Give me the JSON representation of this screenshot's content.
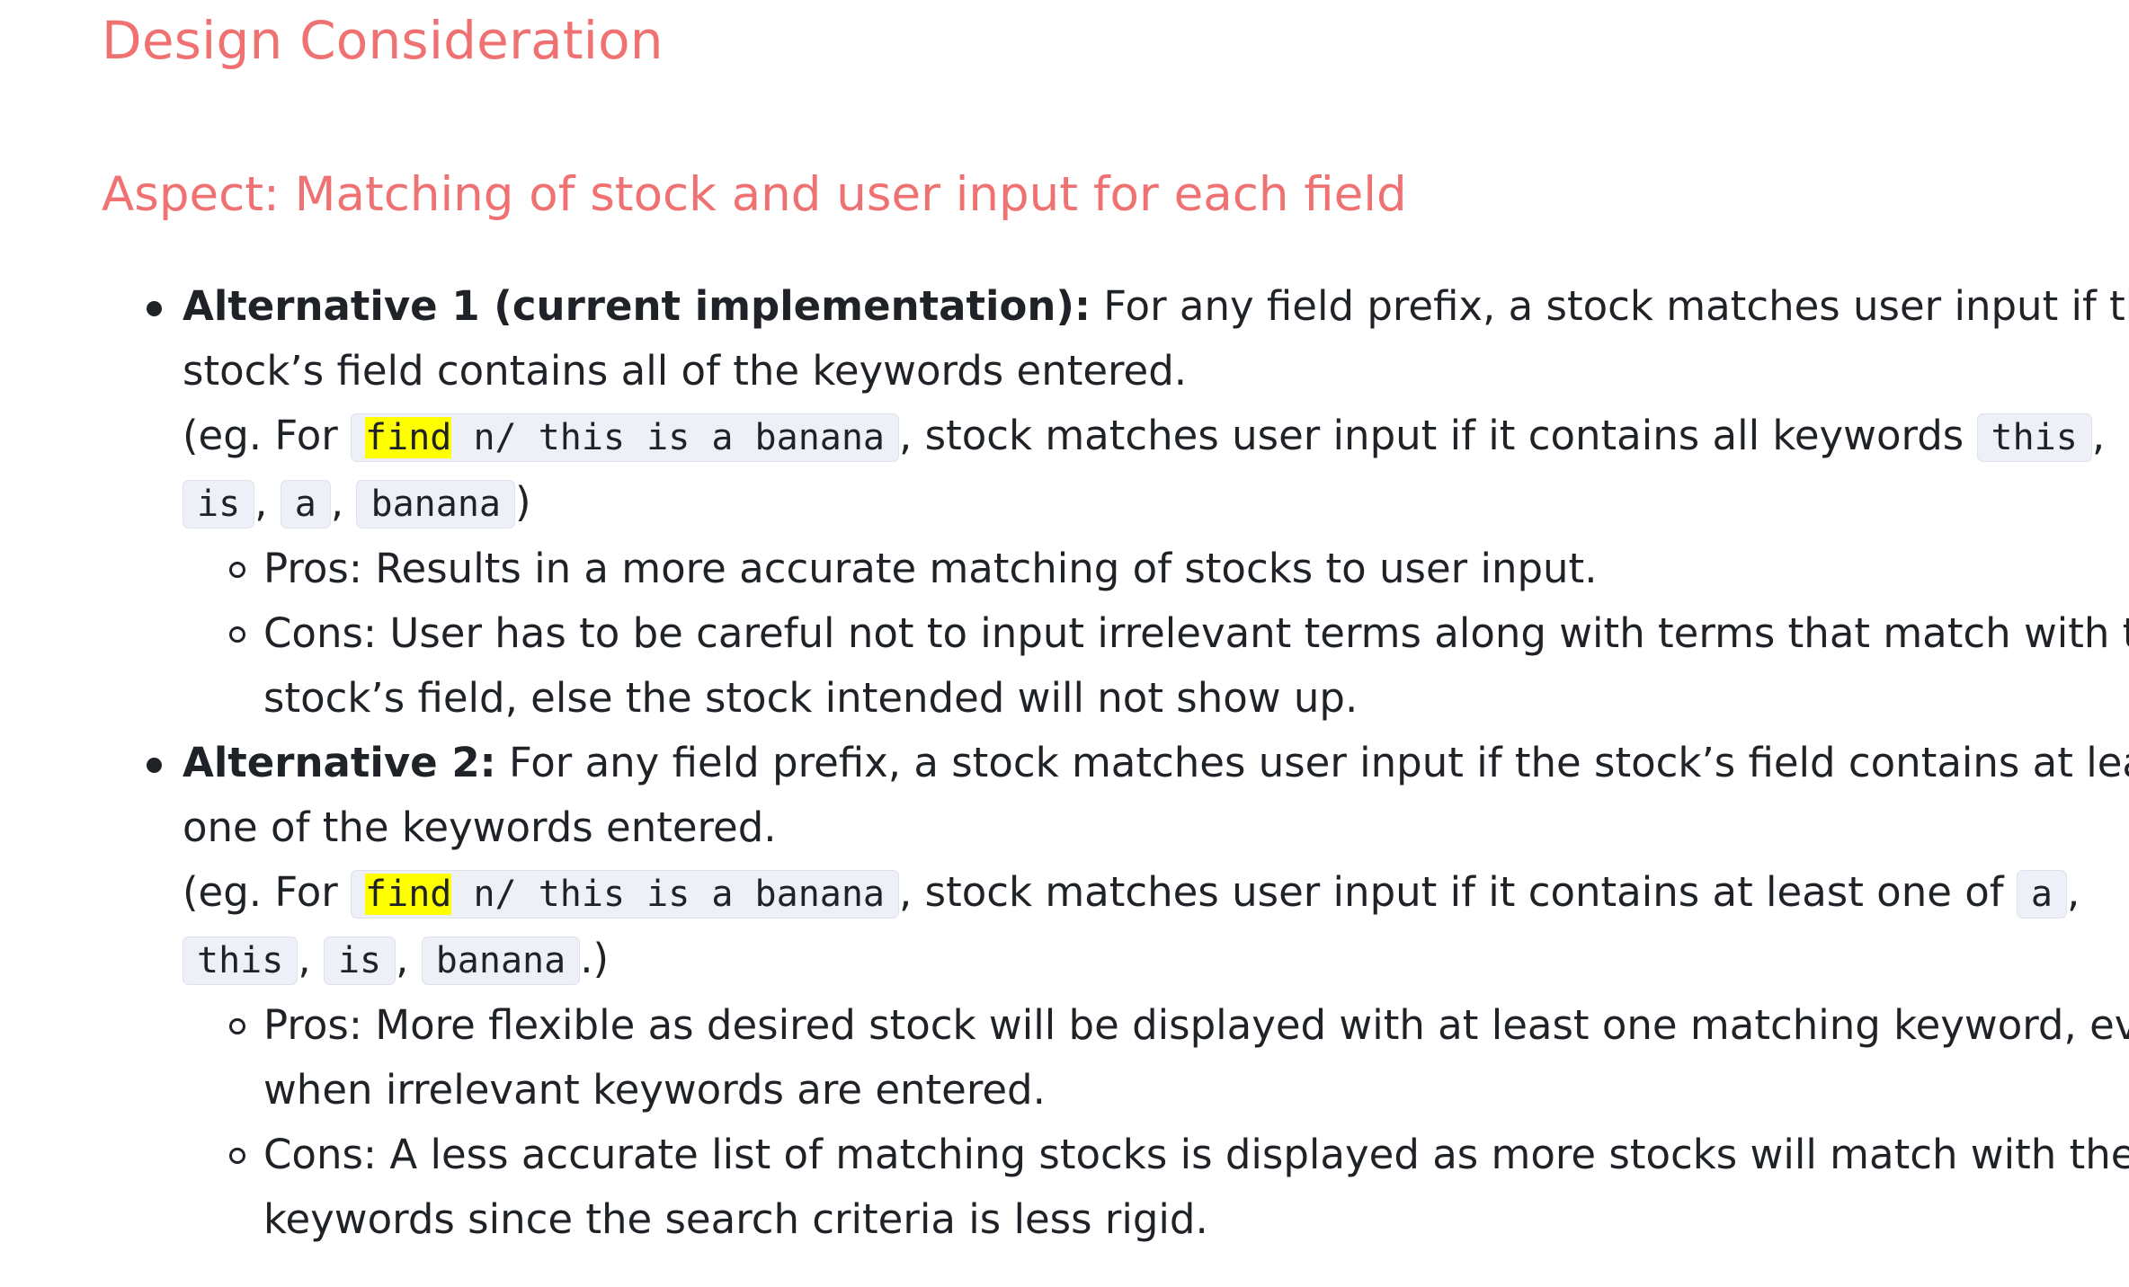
{
  "section_title": "Design Consideration",
  "aspect_title": "Aspect: Matching of stock and user input for each field",
  "alternatives": [
    {
      "name": "Alternative 1 (current implementation):",
      "desc": "For any field prefix, a stock matches user input if the stock’s field contains all of the keywords entered.",
      "eg_prefix": "(eg. For",
      "cmd_highlight": "find",
      "cmd_rest": " n/ this is a banana",
      "eg_middle": ", stock matches user input if it contains all keywords",
      "keywords": [
        "this",
        "is",
        "a",
        "banana"
      ],
      "eg_end": ")",
      "pros": "Pros: Results in a more accurate matching of stocks to user input.",
      "cons": "Cons: User has to be careful not to input irrelevant terms along with terms that match with the stock’s field, else the stock intended will not show up."
    },
    {
      "name": "Alternative 2:",
      "desc": "For any field prefix, a stock matches user input if the stock’s field contains at least one of the keywords entered.",
      "eg_prefix": "(eg. For",
      "cmd_highlight": "find",
      "cmd_rest": " n/ this is a banana",
      "eg_middle": ", stock matches user input if it contains at least one of",
      "keywords": [
        "a",
        "this",
        "is",
        "banana"
      ],
      "eg_end": ".)",
      "pros": "Pros: More flexible as desired stock will be displayed with at least one matching keyword, even when irrelevant keywords are entered.",
      "cons": "Cons: A less accurate list of matching stocks is displayed as more stocks will match with the keywords since the search criteria is less rigid."
    }
  ],
  "colors": {
    "heading": "#f07171",
    "text": "#1f2328",
    "code_bg": "#eef0f8",
    "highlight": "#ffff00"
  }
}
